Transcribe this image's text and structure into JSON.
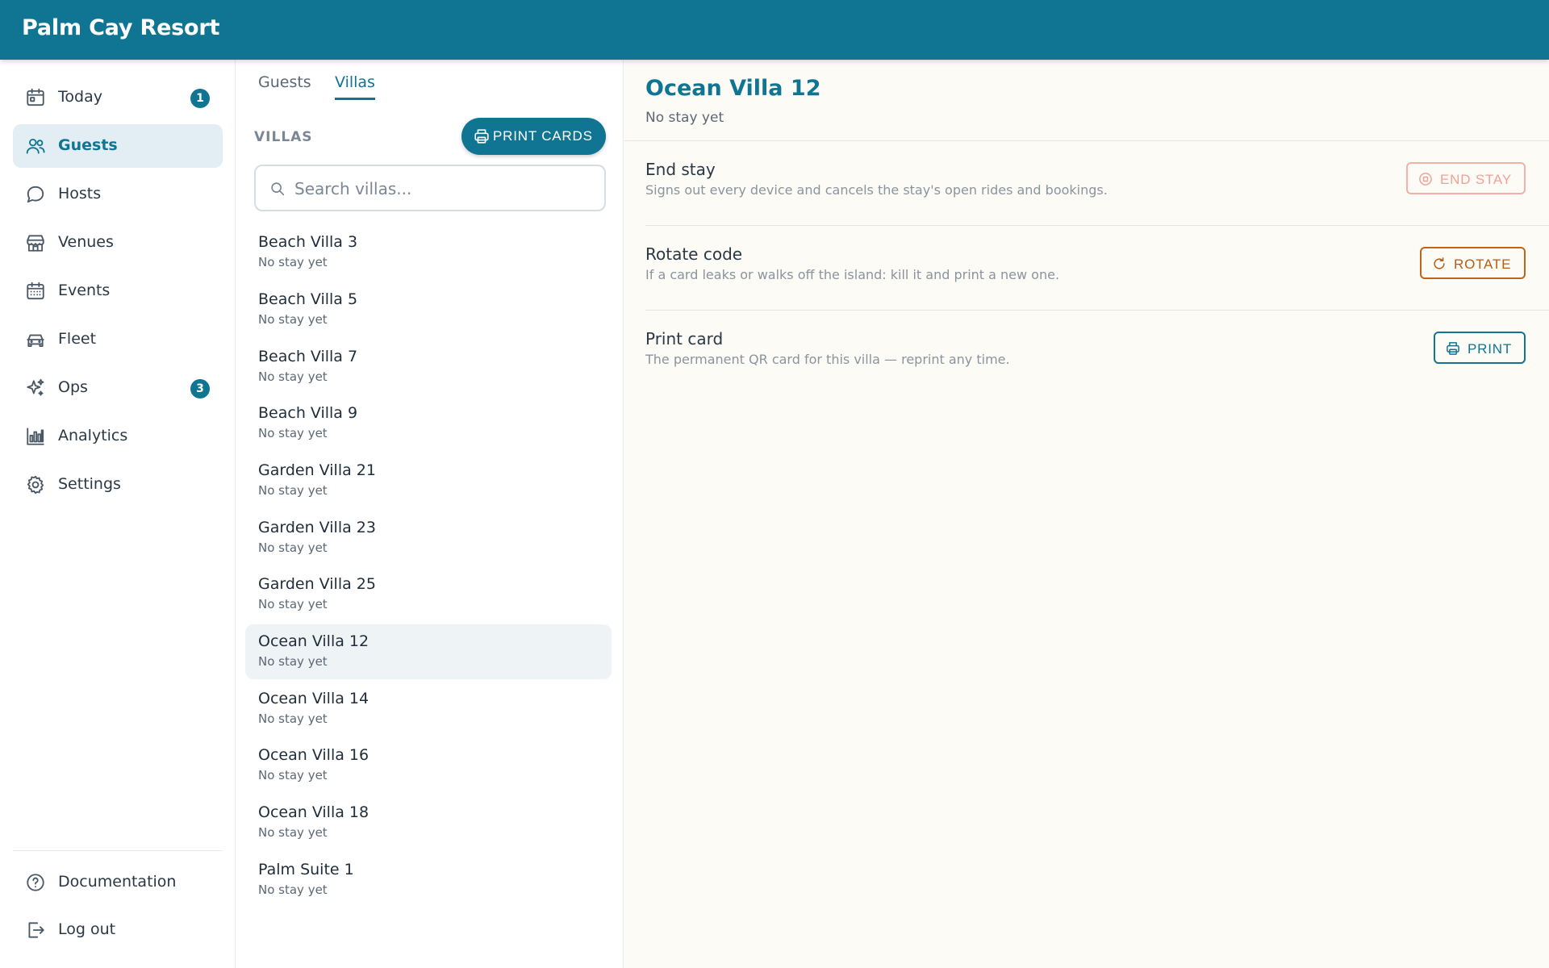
{
  "app": {
    "title": "Palm Cay Resort"
  },
  "sidebar": {
    "items": [
      {
        "label": "Today",
        "icon": "calendar-icon",
        "badge": "1"
      },
      {
        "label": "Guests",
        "icon": "users-icon",
        "active": true
      },
      {
        "label": "Hosts",
        "icon": "chat-bubble-icon"
      },
      {
        "label": "Venues",
        "icon": "storefront-icon"
      },
      {
        "label": "Events",
        "icon": "calendar-grid-icon"
      },
      {
        "label": "Fleet",
        "icon": "car-icon"
      },
      {
        "label": "Ops",
        "icon": "sparkles-icon",
        "badge": "3"
      },
      {
        "label": "Analytics",
        "icon": "bar-chart-icon"
      },
      {
        "label": "Settings",
        "icon": "gear-icon"
      }
    ],
    "footer": [
      {
        "label": "Documentation",
        "icon": "help-circle-icon"
      },
      {
        "label": "Log out",
        "icon": "logout-icon"
      }
    ]
  },
  "list": {
    "tabs": [
      {
        "label": "Guests"
      },
      {
        "label": "Villas",
        "active": true
      }
    ],
    "section_label": "VILLAS",
    "print_cards_label": "PRINT CARDS",
    "search_placeholder": "Search villas...",
    "villas": [
      {
        "name": "Beach Villa 3",
        "status": "No stay yet"
      },
      {
        "name": "Beach Villa 5",
        "status": "No stay yet"
      },
      {
        "name": "Beach Villa 7",
        "status": "No stay yet"
      },
      {
        "name": "Beach Villa 9",
        "status": "No stay yet"
      },
      {
        "name": "Garden Villa 21",
        "status": "No stay yet"
      },
      {
        "name": "Garden Villa 23",
        "status": "No stay yet"
      },
      {
        "name": "Garden Villa 25",
        "status": "No stay yet"
      },
      {
        "name": "Ocean Villa 12",
        "status": "No stay yet",
        "selected": true
      },
      {
        "name": "Ocean Villa 14",
        "status": "No stay yet"
      },
      {
        "name": "Ocean Villa 16",
        "status": "No stay yet"
      },
      {
        "name": "Ocean Villa 18",
        "status": "No stay yet"
      },
      {
        "name": "Palm Suite 1",
        "status": "No stay yet"
      }
    ]
  },
  "detail": {
    "title": "Ocean Villa 12",
    "subtitle": "No stay yet",
    "actions": [
      {
        "title": "End stay",
        "description": "Signs out every device and cancels the stay's open rides and bookings.",
        "button": "END STAY",
        "icon": "stop-circle-icon",
        "disabled": true
      },
      {
        "title": "Rotate code",
        "description": "If a card leaks or walks off the island: kill it and print a new one.",
        "button": "ROTATE",
        "icon": "refresh-icon"
      },
      {
        "title": "Print card",
        "description": "The permanent QR card for this villa — reprint any time.",
        "button": "PRINT",
        "icon": "printer-icon"
      }
    ]
  },
  "colors": {
    "brand": "#0f7593",
    "detail_bg": "#fdfbf6",
    "end_stay": "#eea297",
    "rotate": "#b45d16"
  }
}
